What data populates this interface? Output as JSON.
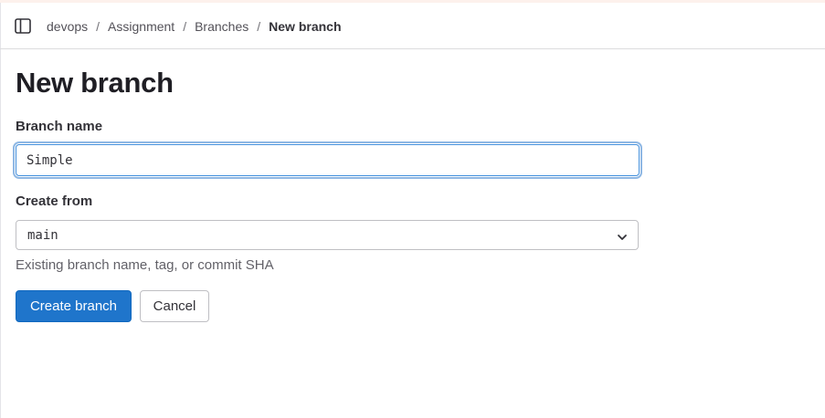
{
  "breadcrumb": {
    "items": [
      "devops",
      "Assignment",
      "Branches"
    ],
    "current": "New branch",
    "separator": "/"
  },
  "icons": {
    "sidebar_toggle": "sidebar-toggle-icon",
    "select_chevron": "chevron-down-icon"
  },
  "page": {
    "title": "New branch"
  },
  "form": {
    "branch_name": {
      "label": "Branch name",
      "value": "Simple"
    },
    "create_from": {
      "label": "Create from",
      "selected": "main",
      "help": "Existing branch name, tag, or commit SHA"
    },
    "submit_label": "Create branch",
    "cancel_label": "Cancel"
  },
  "colors": {
    "primary_button": "#1f75cb",
    "focus_ring": "#428fdc"
  }
}
